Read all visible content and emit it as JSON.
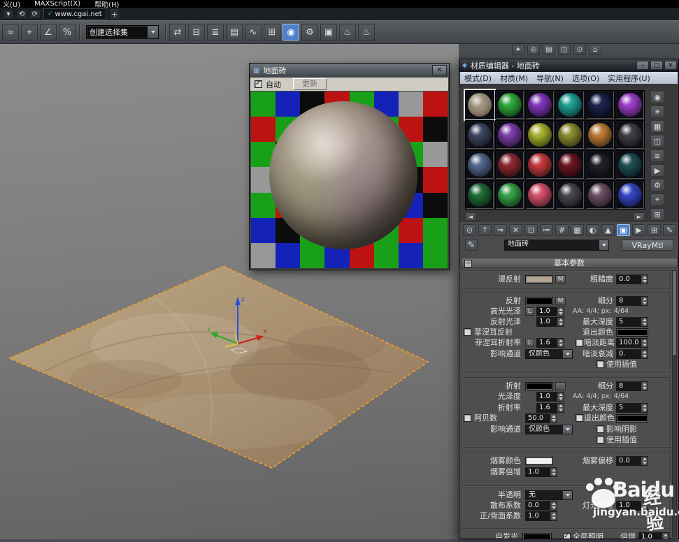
{
  "menu_bar": {
    "items": [
      "义(U)",
      "MAXScript(X)",
      "帮助(H)"
    ]
  },
  "quick_bar": {
    "icons": [
      {
        "name": "workspace-icon",
        "glyph": "▾"
      },
      {
        "name": "undo-icon",
        "glyph": "⟲"
      },
      {
        "name": "redo-icon",
        "glyph": "⟳"
      }
    ],
    "url_check": "✓",
    "url": "www.cgai.net",
    "add": "+"
  },
  "toolbar": {
    "selection_combo": "创建选择集",
    "left_icons": [
      {
        "name": "select-and-link-icon",
        "glyph": "∞"
      },
      {
        "name": "snap-toggle-icon",
        "glyph": "⌖"
      },
      {
        "name": "angle-snap-icon",
        "glyph": "∠"
      },
      {
        "name": "percent-snap-icon",
        "glyph": "%"
      }
    ],
    "right_icons": [
      {
        "name": "mirror-icon",
        "glyph": "⇄"
      },
      {
        "name": "align-icon",
        "glyph": "⊟"
      },
      {
        "name": "layer-manager-icon",
        "glyph": "≣"
      },
      {
        "name": "ribbon-icon",
        "glyph": "▤"
      },
      {
        "name": "curve-editor-icon",
        "glyph": "∿"
      },
      {
        "name": "schematic-view-icon",
        "glyph": "⊞"
      },
      {
        "name": "material-editor-icon",
        "glyph": "◉",
        "active": true
      },
      {
        "name": "render-setup-icon",
        "glyph": "⚙"
      },
      {
        "name": "rendered-frame-icon",
        "glyph": "▣"
      },
      {
        "name": "render-production-icon",
        "glyph": "♨"
      },
      {
        "name": "render-iterative-icon",
        "glyph": "♨"
      }
    ],
    "far_icons": [
      {
        "name": "light-icon",
        "glyph": "✦"
      },
      {
        "name": "camera-icon",
        "glyph": "◎"
      },
      {
        "name": "helpers-icon",
        "glyph": "▤"
      },
      {
        "name": "systems-icon",
        "glyph": "◫"
      },
      {
        "name": "display-icon",
        "glyph": "⊙"
      },
      {
        "name": "utilities-icon",
        "glyph": "⌂"
      }
    ]
  },
  "preview": {
    "title": "地面砖",
    "auto_label": "自动",
    "update_label": "更新",
    "close": "✕",
    "window_icon": "▦",
    "checker": [
      [
        "#19a019",
        "#1522b8",
        "#0c0c0c",
        "#bc1212",
        "#19a019",
        "#1522b8",
        "#989898",
        "#bc1212"
      ],
      [
        "#bc1212",
        "#19a019",
        "#1522b8",
        "#989898",
        "#0c0c0c",
        "#19a019",
        "#bc1212",
        "#0c0c0c"
      ],
      [
        "#19a019",
        "#0c0c0c",
        "#bc1212",
        "#19a019",
        "#1522b8",
        "#989898",
        "#19a019",
        "#989898"
      ],
      [
        "#989898",
        "#1522b8",
        "#19a019",
        "#0c0c0c",
        "#bc1212",
        "#1522b8",
        "#0c0c0c",
        "#bc1212"
      ],
      [
        "#19a019",
        "#bc1212",
        "#989898",
        "#1522b8",
        "#19a019",
        "#0c0c0c",
        "#1522b8",
        "#0c0c0c"
      ],
      [
        "#1522b8",
        "#0c0c0c",
        "#19a019",
        "#bc1212",
        "#989898",
        "#19a019",
        "#bc1212",
        "#19a019"
      ],
      [
        "#989898",
        "#1522b8",
        "#19a019",
        "#1522b8",
        "#bc1212",
        "#19a019",
        "#1522b8",
        "#19a019"
      ]
    ]
  },
  "editor": {
    "title": "材质编辑器 - 地面砖",
    "window_icon": "◆",
    "window_buttons": {
      "min": "–",
      "max": "□",
      "close": "✕"
    },
    "menu": [
      "模式(D)",
      "材质(M)",
      "导航(N)",
      "选项(O)",
      "实用程序(U)"
    ],
    "slots": [
      {
        "marble": true
      },
      {
        "c": "#2fa83c"
      },
      {
        "c": "#7f35b8"
      },
      {
        "c": "#1e9e93"
      },
      {
        "c": "#1c2450"
      },
      {
        "c": "#9b3ec6"
      },
      {
        "c": "#3c4660"
      },
      {
        "c": "#7a3da6"
      },
      {
        "c": "#a6b02e"
      },
      {
        "c": "#8a8a30"
      },
      {
        "c": "#bc7a36"
      },
      {
        "c": "#3e3e44"
      },
      {
        "c": "#53678e"
      },
      {
        "c": "#8a2830"
      },
      {
        "c": "#c23a3e"
      },
      {
        "c": "#6a1622"
      },
      {
        "c": "#202028"
      },
      {
        "c": "#1e4e54"
      },
      {
        "c": "#1f6b35"
      },
      {
        "c": "#36a046"
      },
      {
        "c": "#d4506b"
      },
      {
        "c": "#46464e"
      },
      {
        "c": "#6b4f63"
      },
      {
        "c": "#3546c4"
      }
    ],
    "side_icons": [
      {
        "name": "sample-type-icon",
        "glyph": "◉"
      },
      {
        "name": "backlight-icon",
        "glyph": "☀"
      },
      {
        "name": "background-icon",
        "glyph": "▦"
      },
      {
        "name": "sample-tiling-icon",
        "glyph": "◫"
      },
      {
        "name": "video-color-check-icon",
        "glyph": "≋"
      },
      {
        "name": "make-preview-icon",
        "glyph": "▶"
      },
      {
        "name": "options-icon",
        "glyph": "⚙"
      },
      {
        "name": "select-by-material-icon",
        "glyph": "⌖"
      },
      {
        "name": "material-map-navigator-icon",
        "glyph": "⊞"
      }
    ],
    "tool_icons": [
      {
        "name": "get-material-icon",
        "glyph": "⊙"
      },
      {
        "name": "put-to-scene-icon",
        "glyph": "↑"
      },
      {
        "name": "assign-to-selection-icon",
        "glyph": "⇒"
      },
      {
        "name": "reset-map-icon",
        "glyph": "✕"
      },
      {
        "name": "make-unique-icon",
        "glyph": "⊡"
      },
      {
        "name": "put-to-library-icon",
        "glyph": "≔"
      },
      {
        "name": "material-id-icon",
        "glyph": "#"
      },
      {
        "name": "show-background-icon",
        "glyph": "▦"
      },
      {
        "name": "show-end-result-icon",
        "glyph": "◐"
      },
      {
        "name": "go-to-parent-icon",
        "glyph": "▲"
      },
      {
        "name": "show-map-in-viewport-icon",
        "glyph": "▣",
        "active": true
      },
      {
        "name": "go-forward-icon",
        "glyph": "▶"
      },
      {
        "name": "sample-uv-tiling-icon",
        "glyph": "⊞"
      },
      {
        "name": "pick-material-icon",
        "glyph": "✎"
      }
    ],
    "scroll_left": "◄",
    "scroll_right": "►",
    "dropper_icon": "✎",
    "material_name": "地面砖",
    "material_class": "VRayMtl",
    "rollout_title": "基本参数",
    "params": {
      "m_label": "M",
      "l_label": "L",
      "diffuse_label": "漫反射",
      "roughness_label": "粗糙度",
      "roughness_value": "0.0",
      "reflect_label": "反射",
      "subdivs_label": "细分",
      "reflect_subdivs": "8",
      "hilight_gloss_label": "高光光泽",
      "hilight_gloss_value": "1.0",
      "aa_text": "AA: 4/4; px: 4/64",
      "reflect_gloss_label": "反射光泽",
      "reflect_gloss_value": "1.0",
      "max_depth_label": "最大深度",
      "reflect_max_depth": "5",
      "fresnel_label": "菲涅耳反射",
      "exit_color_label": "退出颜色",
      "fresnel_ior_label": "菲涅耳折射率",
      "fresnel_ior_value": "1.6",
      "dim_distance_label": "暗淡距离",
      "dim_distance_value": "100.0",
      "affect_channels_label": "影响通道",
      "affect_channels_value": "仅颜色",
      "dim_falloff_label": "暗淡衰减",
      "dim_falloff_value": "0.",
      "use_interpolation_label": "使用插值",
      "refract_label": "折射",
      "refract_subdivs": "8",
      "gloss_label": "光泽度",
      "gloss_value": "1.0",
      "ior_label": "折射率",
      "ior_value": "1.6",
      "refract_max_depth": "5",
      "abbe_label": "阿贝数",
      "abbe_value": "50.0",
      "affect_shadows_label": "影响阴影",
      "fog_color_label": "烟雾颜色",
      "fog_bias_label": "烟雾偏移",
      "fog_bias_value": "0.0",
      "fog_mult_label": "烟雾倍增",
      "fog_mult_value": "1.0",
      "translucency_label": "半透明",
      "translucency_value": "无",
      "scatter_label": "散布系数",
      "scatter_value": "0.0",
      "light_mult_label": "灯光倍增",
      "light_mult_value": "1.0",
      "fb_coeff_label": "正/背面系数",
      "fb_coeff_value": "1.0",
      "self_illum_label": "自发光",
      "gi_label": "全局照明",
      "mult_label": "倍增",
      "gi_mult_value": "1.0"
    }
  },
  "watermark": {
    "brand": "Baidu",
    "script": "经验",
    "url": "jingyan.baidu.com"
  }
}
